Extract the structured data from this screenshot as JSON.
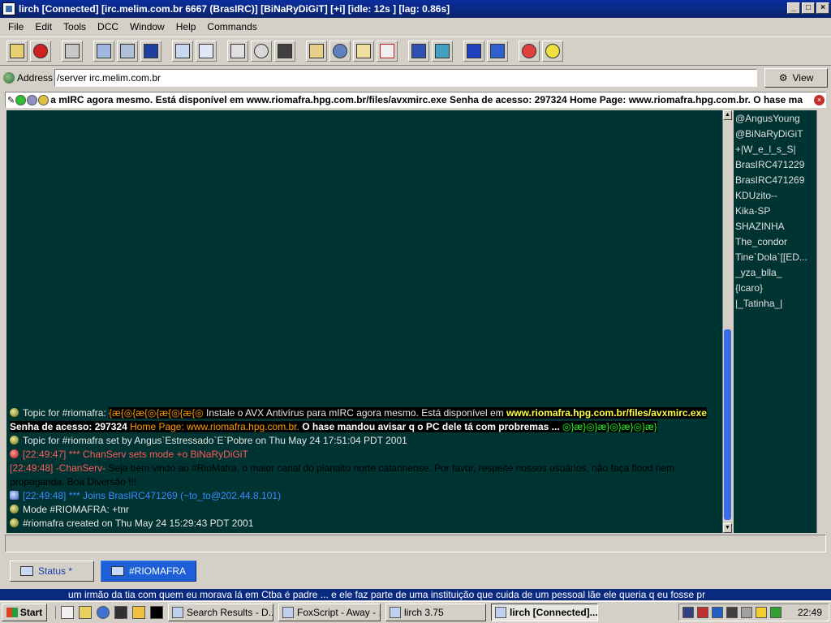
{
  "window": {
    "title": "lirch [Connected] [irc.melim.com.br 6667 (BrasIRC)] [BiNaRyDiGiT] [+i] [idle: 12s ] [lag: 0.86s]",
    "buttons": [
      "_",
      "□",
      "×"
    ]
  },
  "menu": [
    {
      "label": "File"
    },
    {
      "label": "Edit"
    },
    {
      "label": "Tools"
    },
    {
      "label": "DCC"
    },
    {
      "label": "Window"
    },
    {
      "label": "Help"
    },
    {
      "label": "Commands"
    }
  ],
  "toolbar": {
    "icons": [
      "options-icon",
      "disconnect-icon",
      "channel-list-icon",
      "server-list-icon",
      "windows-icon",
      "notify-icon",
      "text-icon",
      "log-icon",
      "print-icon",
      "urls-icon",
      "ignore-icon",
      "folder-icon",
      "chat-icon",
      "edit-icon",
      "dcc-icon",
      "script-icon",
      "tools-icon",
      "tile-icon",
      "cascade-icon",
      "help-icon",
      "tip-icon"
    ]
  },
  "address": {
    "label": "Address",
    "value": "/server irc.melim.com.br",
    "view_button": "View"
  },
  "topic_bar": {
    "text": "a mIRC agora mesmo. Está disponível em www.riomafra.hpg.com.br/files/avxmirc.exe Senha de acesso: 297324 Home Page: www.riomafra.hpg.com.br. O hase ma"
  },
  "chat": {
    "topic_prefix": "Topic for #riomafra:",
    "topic_decor_1": "{æ{◎{æ{◎{æ{◎{æ{◎",
    "topic_body_1": "Instale o AVX Antivírus para mIRC agora mesmo. Está disponível em",
    "topic_link": "www.riomafra.hpg.com.br/files/avxmirc.exe",
    "topic_pass": "Senha de acesso: 297324",
    "topic_home_label": "Home Page:",
    "topic_home": "www.riomafra.hpg.com.br.",
    "topic_tail": "O hase mandou avisar q o PC dele tá com probremas ...",
    "topic_decor_2": "◎}æ}◎}æ}◎}æ}◎}æ}",
    "topic_set": "Topic for #riomafra set by Angus`Estressado`E`Pobre on Thu May 24 17:51:04 PDT 2001",
    "mode_line": "[22:49:47] *** ChanServ sets mode +o BiNaRyDiGiT",
    "notice_time": "[22:49:48]",
    "notice_from": "-ChanServ-",
    "notice_text": "Seja bem vindo ao #RioMafra, o maior canal do planalto norte catarinense. Por favor, respeite nossos usuários, não faça flood nem propaganda. Boa Diversão !!!",
    "join_line": "[22:49:48] *** Joins BrasIRC471269 (~to_to@202.44.8.101)",
    "mode_riomafra": "Mode #RIOMAFRA: +tnr",
    "created": "#riomafra created on Thu May 24 15:29:43 PDT 2001"
  },
  "nicklist": [
    "@AngusYoung",
    "@BiNaRyDiGiT",
    "+|W_e_l_s_S|",
    "BrasIRC471229",
    "BrasIRC471269",
    "KDUzito--",
    "Kika-SP",
    "SHAZINHA",
    "The_condor",
    "Tine`Dola`[[ED...",
    "_yza_blla_",
    "{lcaro}",
    "|_Tatinha_|"
  ],
  "tabs": [
    {
      "label": "Status *",
      "active": false
    },
    {
      "label": "#RIOMAFRA",
      "active": true
    }
  ],
  "marquee": {
    "text": "um irmão da tia com quem eu morava lá em Ctba é padre ... e ele faz parte de uma instituição que cuida de um pessoal lãe ele queria q eu fosse pr"
  },
  "taskbar": {
    "start": "Start",
    "tasks": [
      {
        "label": "Search Results - D...",
        "active": false
      },
      {
        "label": "FoxScript - Away - ...",
        "active": false
      },
      {
        "label": "lirch 3.75",
        "active": false
      },
      {
        "label": "lirch [Connected]...",
        "active": true
      }
    ],
    "clock": "22:49"
  },
  "colors": {
    "chat_bg": "#003432",
    "titlebar": "#0a246a",
    "active_tab": "#1c5fd6"
  }
}
